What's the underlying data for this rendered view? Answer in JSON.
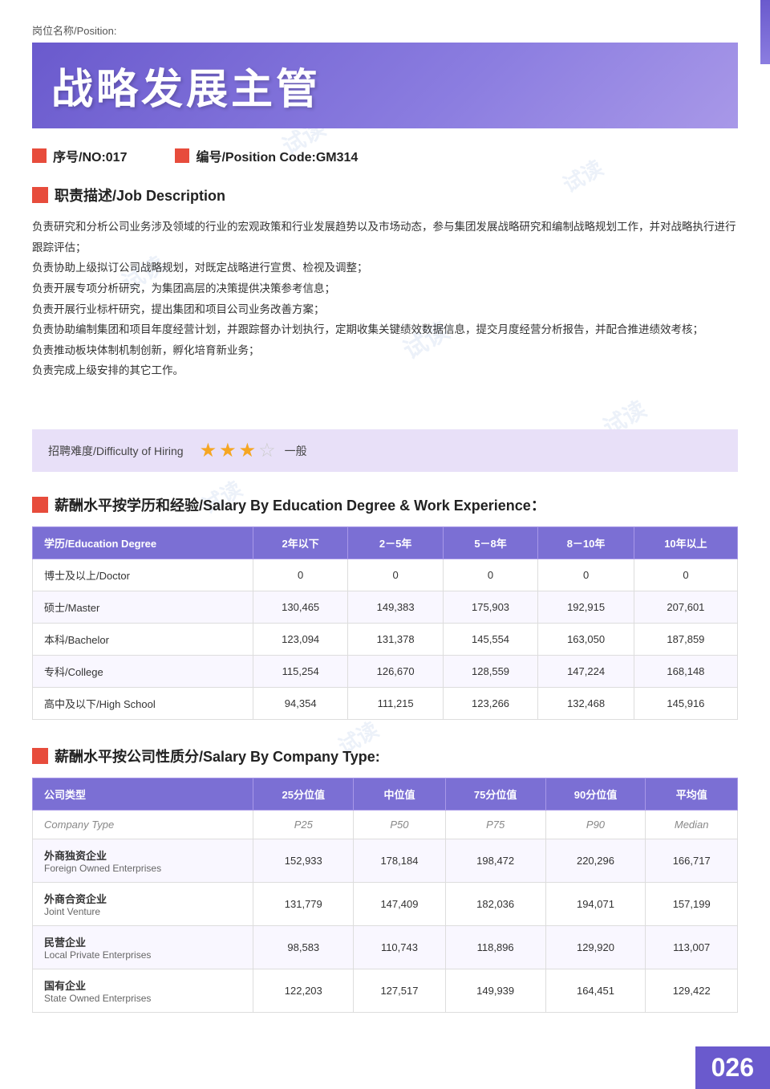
{
  "header": {
    "position_label": "岗位名称/Position:",
    "title": "战略发展主管",
    "no_label": "序号/NO:017",
    "code_label": "编号/Position Code:GM314"
  },
  "job_description": {
    "section_title": "职责描述/Job Description",
    "lines": [
      "负责研究和分析公司业务涉及领域的行业的宏观政策和行业发展趋势以及市场动态，参与集团发展战略研究和编制战略规划工作，并对战略执行进行跟踪评估；",
      "负责协助上级拟订公司战略规划，对既定战略进行宣贯、检视及调整；",
      "负责开展专项分析研究，为集团高层的决策提供决策参考信息；",
      "负责开展行业标杆研究，提出集团和项目公司业务改善方案；",
      "负责协助编制集团和项目年度经营计划，并跟踪督办计划执行，定期收集关键绩效数据信息，提交月度经营分析报告，并配合推进绩效考核；",
      "负责推动板块体制机制创新，孵化培育新业务；",
      "负责完成上级安排的其它工作。"
    ]
  },
  "difficulty": {
    "label": "招聘难度/Difficulty of Hiring",
    "stars_filled": 3,
    "stars_empty": 1,
    "text": "一般"
  },
  "salary_education": {
    "section_title": "薪酬水平按学历和经验/Salary By Education Degree & Work Experience：",
    "headers": [
      "学历/Education Degree",
      "2年以下",
      "2－5年",
      "5－8年",
      "8－10年",
      "10年以上"
    ],
    "rows": [
      {
        "degree": "博士及以上/Doctor",
        "vals": [
          "0",
          "0",
          "0",
          "0",
          "0"
        ]
      },
      {
        "degree": "硕士/Master",
        "vals": [
          "130,465",
          "149,383",
          "175,903",
          "192,915",
          "207,601"
        ]
      },
      {
        "degree": "本科/Bachelor",
        "vals": [
          "123,094",
          "131,378",
          "145,554",
          "163,050",
          "187,859"
        ]
      },
      {
        "degree": "专科/College",
        "vals": [
          "115,254",
          "126,670",
          "128,559",
          "147,224",
          "168,148"
        ]
      },
      {
        "degree": "高中及以下/High School",
        "vals": [
          "94,354",
          "111,215",
          "123,266",
          "132,468",
          "145,916"
        ]
      }
    ]
  },
  "salary_company": {
    "section_title": "薪酬水平按公司性质分/Salary By Company Type:",
    "headers": [
      "公司类型",
      "25分位值",
      "中位值",
      "75分位值",
      "90分位值",
      "平均值"
    ],
    "subheaders": [
      "Company Type",
      "P25",
      "P50",
      "P75",
      "P90",
      "Median"
    ],
    "rows": [
      {
        "cn": "外商独资企业",
        "en": "Foreign Owned Enterprises",
        "vals": [
          "152,933",
          "178,184",
          "198,472",
          "220,296",
          "166,717"
        ]
      },
      {
        "cn": "外商合资企业",
        "en": "Joint Venture",
        "vals": [
          "131,779",
          "147,409",
          "182,036",
          "194,071",
          "157,199"
        ]
      },
      {
        "cn": "民营企业",
        "en": "Local Private Enterprises",
        "vals": [
          "98,583",
          "110,743",
          "118,896",
          "129,920",
          "113,007"
        ]
      },
      {
        "cn": "国有企业",
        "en": "State Owned Enterprises",
        "vals": [
          "122,203",
          "127,517",
          "149,939",
          "164,451",
          "129,422"
        ]
      }
    ]
  },
  "page_number": "026",
  "watermark_text": "试读"
}
